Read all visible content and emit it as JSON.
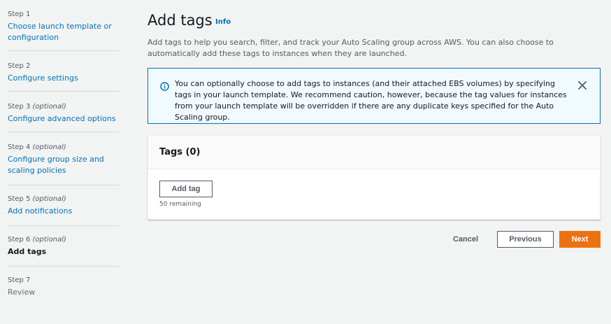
{
  "wizard": {
    "steps": [
      {
        "number": "Step 1",
        "optional": "",
        "label": "Choose launch template or configuration",
        "state": "link"
      },
      {
        "number": "Step 2",
        "optional": "",
        "label": "Configure settings",
        "state": "link"
      },
      {
        "number": "Step 3",
        "optional": "(optional)",
        "label": "Configure advanced options",
        "state": "link"
      },
      {
        "number": "Step 4",
        "optional": "(optional)",
        "label": "Configure group size and scaling policies",
        "state": "link"
      },
      {
        "number": "Step 5",
        "optional": "(optional)",
        "label": "Add notifications",
        "state": "link"
      },
      {
        "number": "Step 6",
        "optional": "(optional)",
        "label": "Add tags",
        "state": "current"
      },
      {
        "number": "Step 7",
        "optional": "",
        "label": "Review",
        "state": "disabled"
      }
    ]
  },
  "header": {
    "title": "Add tags",
    "info_label": "Info",
    "description": "Add tags to help you search, filter, and track your Auto Scaling group across AWS. You can also choose to automatically add these tags to instances when they are launched."
  },
  "alert": {
    "icon": "info-circle-icon",
    "text": "You can optionally choose to add tags to instances (and their attached EBS volumes) by specifying tags in your launch template. We recommend caution, however, because the tag values for instances from your launch template will be overridden if there are any duplicate keys specified for the Auto Scaling group.",
    "close_icon": "close-icon"
  },
  "tags_panel": {
    "title": "Tags (0)",
    "add_button_label": "Add tag",
    "remaining_text": "50 remaining"
  },
  "footer": {
    "cancel_label": "Cancel",
    "previous_label": "Previous",
    "next_label": "Next"
  },
  "colors": {
    "link": "#0073bb",
    "primary_button": "#ec7211",
    "alert_border": "#0073bb",
    "alert_background": "#f1faff"
  }
}
